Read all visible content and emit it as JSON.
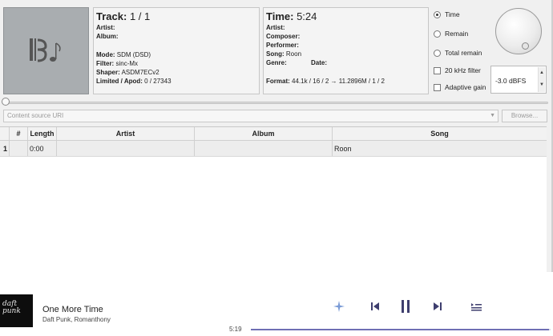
{
  "track_panel": {
    "track_label": "Track:",
    "track_value": "1 / 1",
    "artist_label": "Artist:",
    "album_label": "Album:",
    "mode_label": "Mode:",
    "mode_value": "SDM (DSD)",
    "filter_label": "Filter:",
    "filter_value": "sinc-Mx",
    "shaper_label": "Shaper:",
    "shaper_value": "ASDM7ECv2",
    "limited_label": "Limited / Apod:",
    "limited_value": "0 / 27343"
  },
  "time_panel": {
    "time_label": "Time:",
    "time_value": "5:24",
    "artist_label": "Artist:",
    "composer_label": "Composer:",
    "performer_label": "Performer:",
    "song_label": "Song:",
    "song_value": "Roon",
    "genre_label": "Genre:",
    "date_label": "Date:",
    "format_label": "Format:",
    "format_value": "44.1k / 16 / 2 → 11.2896M / 1 / 2"
  },
  "options": {
    "radio_time": "Time",
    "radio_remain": "Remain",
    "radio_total_remain": "Total remain",
    "selected_radio": "Time",
    "check_20khz": "20 kHz filter",
    "check_adaptive": "Adaptive gain",
    "gain_value": "-3.0 dBFS"
  },
  "source": {
    "uri_placeholder": "Content source URI",
    "browse_label": "Browse..."
  },
  "playlist": {
    "columns": [
      "#",
      "Length",
      "Artist",
      "Album",
      "Song"
    ],
    "rows": [
      {
        "num": "1",
        "length": "0:00",
        "artist": "",
        "album": "",
        "song": "Roon"
      }
    ]
  },
  "player": {
    "cover_text": "daft punk",
    "title": "One More Time",
    "artist": "Daft Punk, Romanthony",
    "elapsed": "5:19",
    "progress_fraction": 0.995,
    "accent_color": "#6f6fb4"
  }
}
